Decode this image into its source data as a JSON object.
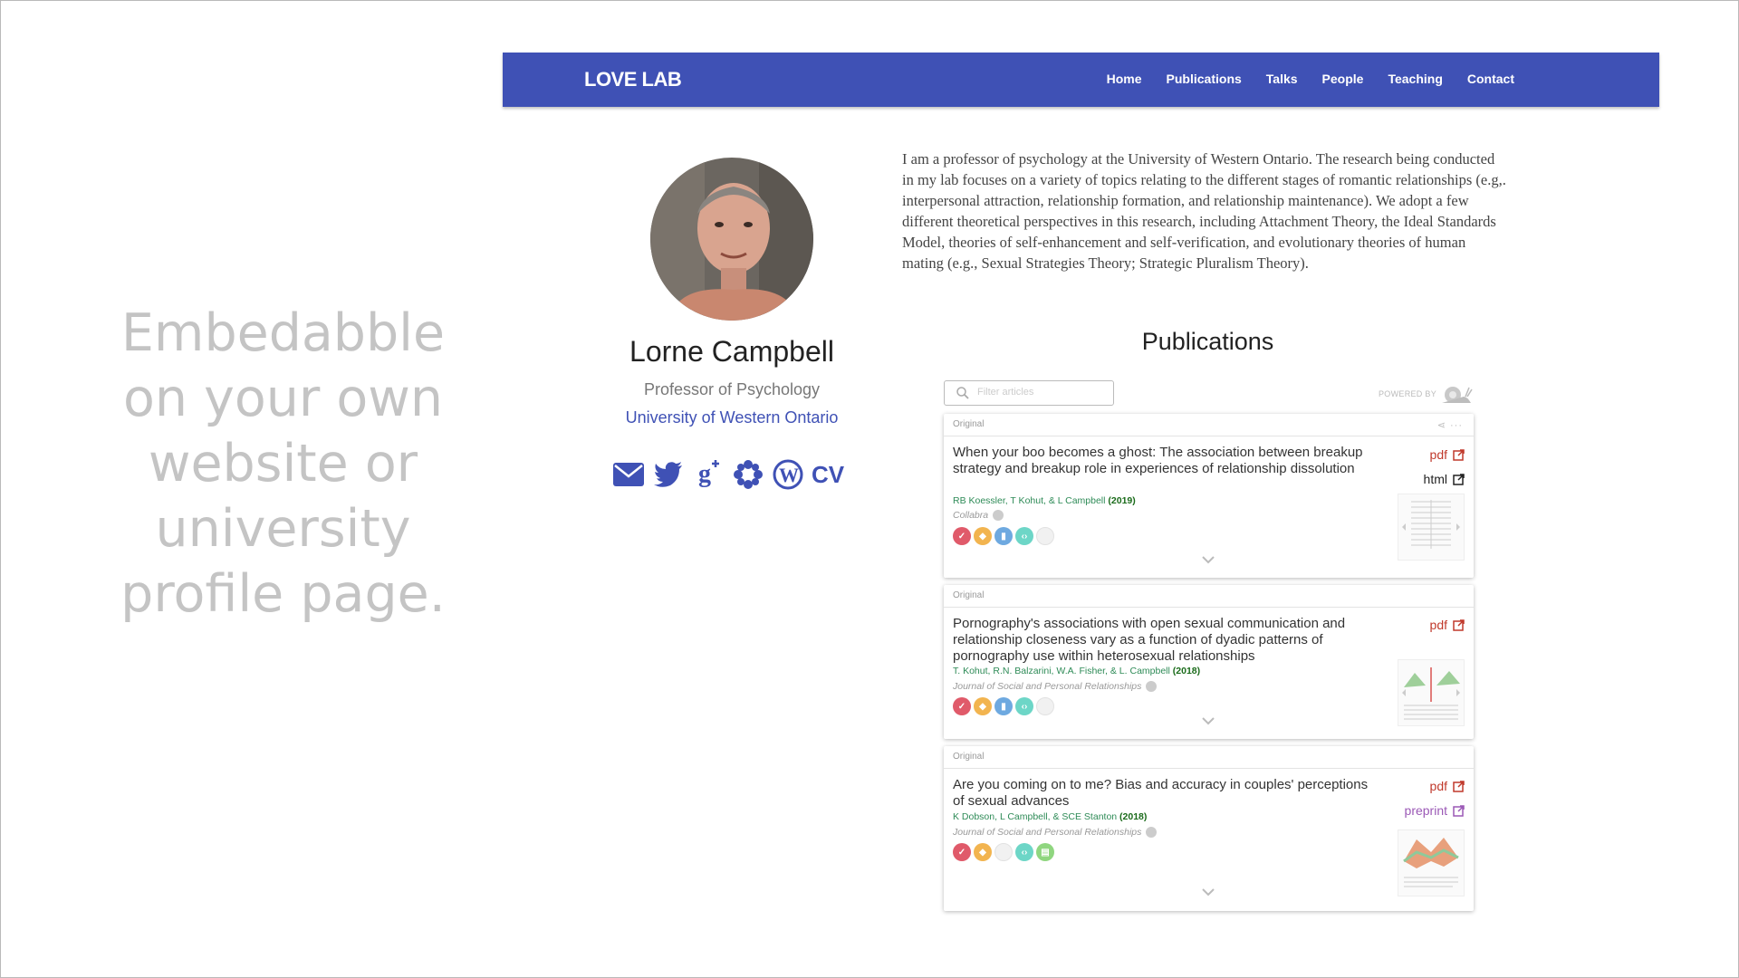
{
  "tagline": [
    "Embedabble",
    "on your own",
    "website or",
    "university",
    "profile page."
  ],
  "navbar": {
    "brand": "LOVE LAB",
    "links": [
      "Home",
      "Publications",
      "Talks",
      "People",
      "Teaching",
      "Contact"
    ],
    "background": "#3f51b5"
  },
  "profile": {
    "name": "Lorne Campbell",
    "role": "Professor of Psychology",
    "university": "University of Western Ontario",
    "icons": [
      "envelope-icon",
      "twitter-icon",
      "google-scholar-icon",
      "osf-icon",
      "wordpress-icon"
    ],
    "cv_label": "CV"
  },
  "bio": "I am a professor of psychology at the University of Western Ontario. The research being conducted in my lab focuses on a variety of topics relating to the different stages of romantic relationships (e.g,. interpersonal attraction, relationship formation, and relationship maintenance). We adopt a few different theoretical perspectives in this research, including Attachment Theory, the Ideal Standards Model, theories of self-enhancement and self-verification, and evolutionary theories of human mating (e.g., Sexual Strategies Theory; Strategic Pluralism Theory).",
  "publications": {
    "heading": "Publications",
    "filter_placeholder": "Filter articles",
    "powered_by": "POWERED BY",
    "items": [
      {
        "label": "Original",
        "title": "When your boo becomes a ghost: The association between breakup strategy and breakup role in experiences of relationship dissolution",
        "authors": "RB Koessler, T Kohut, & L Campbell",
        "year": "(2019)",
        "journal": "Collabra",
        "links": [
          "pdf",
          "html"
        ]
      },
      {
        "label": "Original",
        "title": "Pornography's associations with open sexual communication and relationship closeness vary as a function of dyadic patterns of pornography use within heterosexual relationships",
        "authors": "T. Kohut, R.N. Balzarini, W.A. Fisher, & L. Campbell",
        "year": "(2018)",
        "journal": "Journal of Social and Personal Relationships",
        "links": [
          "pdf"
        ]
      },
      {
        "label": "Original",
        "title": "Are you coming on to me? Bias and accuracy in couples' perceptions of sexual advances",
        "authors": "K Dobson, L Campbell, & SCE Stanton",
        "year": "(2018)",
        "journal": "Journal of Social and Personal Relationships",
        "links": [
          "pdf",
          "preprint"
        ]
      }
    ]
  },
  "colors": {
    "accent": "#3f51b5",
    "tagline": "#c4c4c4",
    "pdf": "#c0392b",
    "preprint": "#9b59b6",
    "authors": "#2e8b57"
  }
}
